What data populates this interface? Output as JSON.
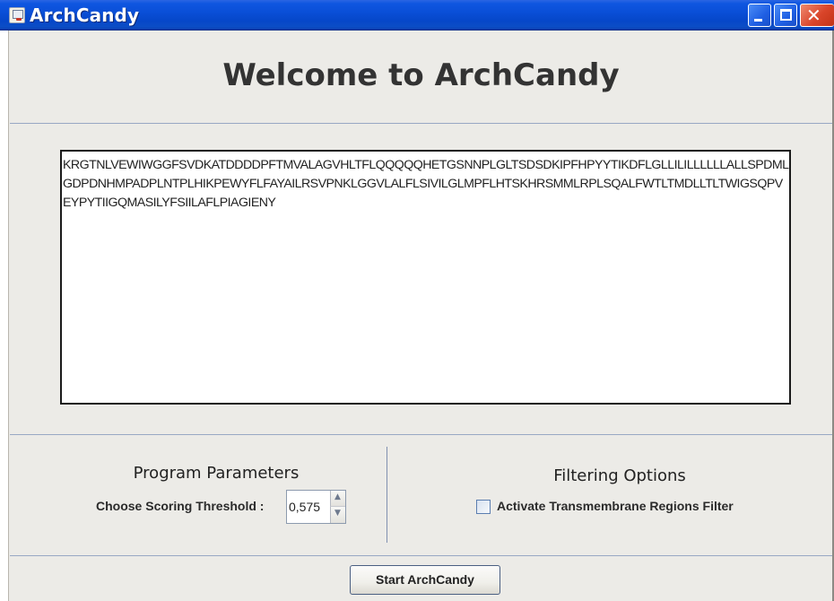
{
  "window": {
    "title": "ArchCandy"
  },
  "titlebar": {
    "close_glyph": "✕"
  },
  "main": {
    "heading": "Welcome to ArchCandy",
    "sequence": "KRGTNLVEWIWGGFSVDKATDDDDPFTMVALAGVHLTFLQQQQQHETGSNNPLGLTSDSDKIPFHPYYTIKDFLGLLILILLLLLLALLSPDMLGDPDNHMPADPLNTPLHIKPEWYFLFAYAILRSVPNKLGGVLALFLSIVILGLMPFLHTSKHRSMMLRPLSQALFWTLTMDLLTLTWIGSQPVEYPYTIIGQMASILYFSIILAFLPIAGIENY"
  },
  "parameters": {
    "title": "Program Parameters",
    "threshold_label": "Choose Scoring Threshold :",
    "threshold_value": "0,575"
  },
  "filtering": {
    "title": "Filtering Options",
    "transmembrane_label": "Activate Transmembrane Regions Filter",
    "transmembrane_checked": false
  },
  "actions": {
    "start_label": "Start ArchCandy"
  },
  "icons": {
    "app": "java-cup-icon",
    "minimize": "minimize-icon",
    "maximize": "maximize-icon",
    "close": "close-icon"
  },
  "colors": {
    "titlebar": "#0a4fd8",
    "close_button": "#d9452a",
    "panel_background": "#ecebe7",
    "separator": "#98a8c4"
  }
}
